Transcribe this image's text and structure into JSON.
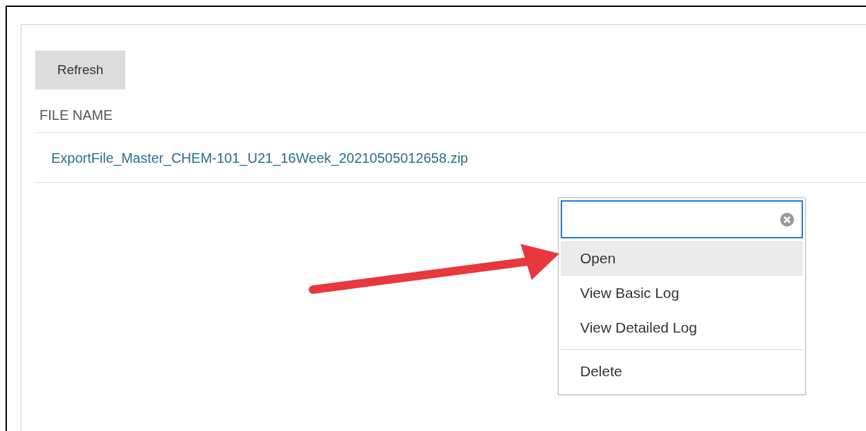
{
  "toolbar": {
    "refresh_button": "Refresh"
  },
  "table": {
    "columns": [
      "FILE NAME"
    ],
    "rows": [
      {
        "file_name": "ExportFile_Master_CHEM-101_U21_16Week_20210505012658.zip"
      }
    ]
  },
  "context_menu": {
    "groups": [
      [
        {
          "label": "Open",
          "selected": true
        },
        {
          "label": "View Basic Log",
          "selected": false
        },
        {
          "label": "View Detailed Log",
          "selected": false
        }
      ],
      [
        {
          "label": "Delete",
          "selected": false
        }
      ]
    ]
  }
}
